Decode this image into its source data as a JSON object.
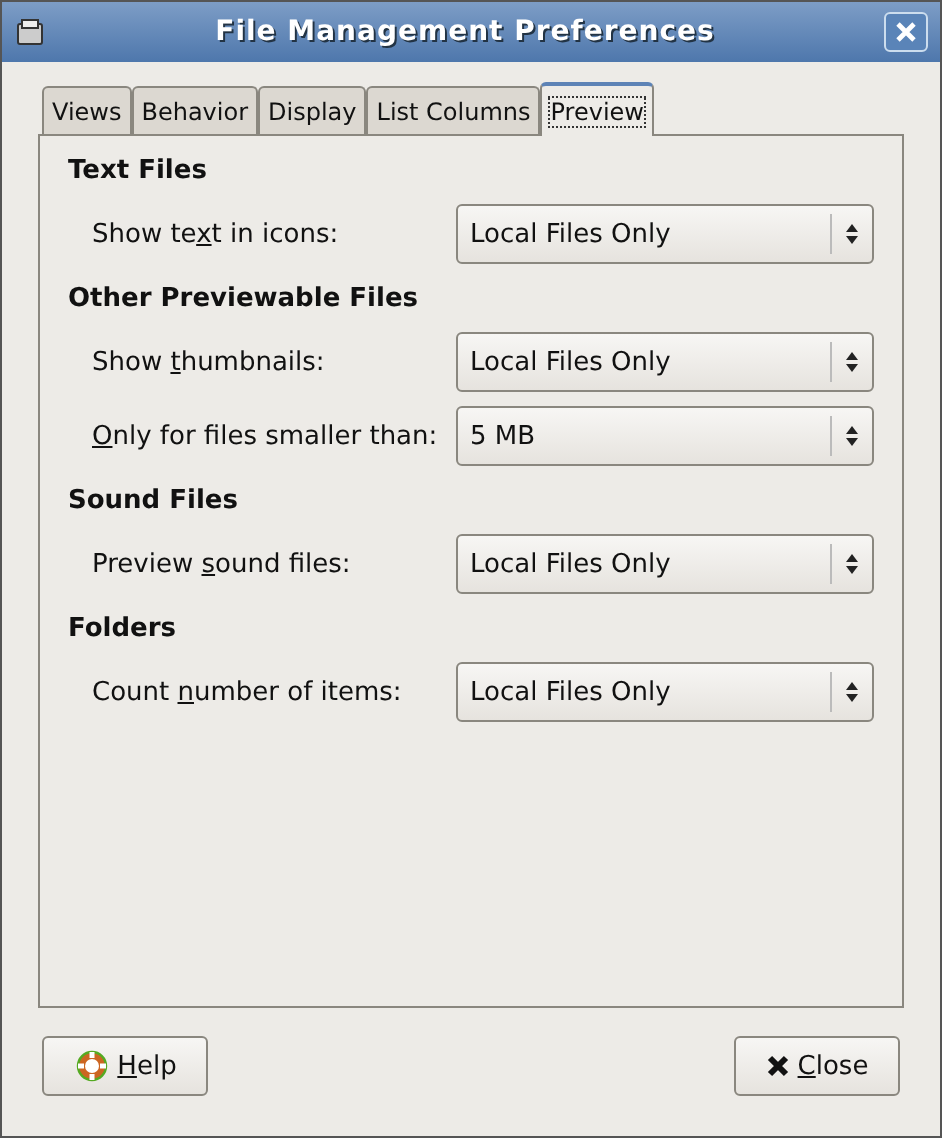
{
  "window": {
    "title": "File Management Preferences"
  },
  "tabs": [
    {
      "label": "Views",
      "selected": false
    },
    {
      "label": "Behavior",
      "selected": false
    },
    {
      "label": "Display",
      "selected": false
    },
    {
      "label": "List Columns",
      "selected": false
    },
    {
      "label": "Preview",
      "selected": true
    }
  ],
  "sections": [
    {
      "title": "Text Files",
      "rows": [
        {
          "label": {
            "before": "Show te",
            "key": "x",
            "after": "t in icons:"
          },
          "value": "Local Files Only"
        }
      ]
    },
    {
      "title": "Other Previewable Files",
      "rows": [
        {
          "label": {
            "before": "Show ",
            "key": "t",
            "after": "humbnails:"
          },
          "value": "Local Files Only"
        },
        {
          "label": {
            "key": "O",
            "after": "nly for files smaller than:"
          },
          "value": "5 MB"
        }
      ]
    },
    {
      "title": "Sound Files",
      "rows": [
        {
          "label": {
            "before": "Preview ",
            "key": "s",
            "after": "ound files:"
          },
          "value": "Local Files Only"
        }
      ]
    },
    {
      "title": "Folders",
      "rows": [
        {
          "label": {
            "before": "Count ",
            "key": "n",
            "after": "umber of items:"
          },
          "value": "Local Files Only"
        }
      ]
    }
  ],
  "buttons": [
    {
      "kind": "help",
      "label": {
        "key": "H",
        "after": "elp"
      }
    },
    {
      "kind": "close",
      "label": {
        "key": "C",
        "after": "lose"
      }
    }
  ]
}
